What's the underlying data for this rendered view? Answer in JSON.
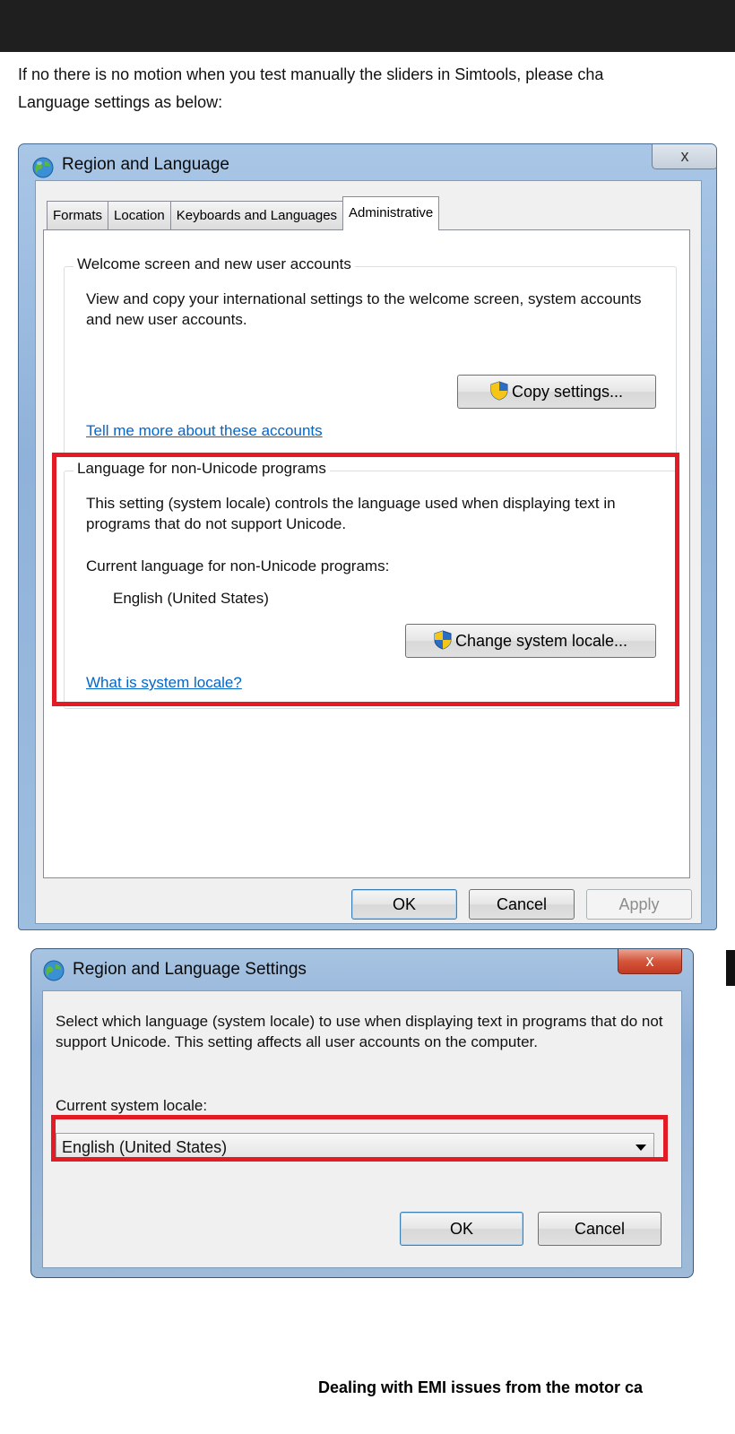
{
  "intro": {
    "line1": "If no there is no motion when you test manually the sliders in Simtools, please cha",
    "line2": "Language settings as below:"
  },
  "window1": {
    "title": "Region and Language",
    "close_glyph": "x",
    "tabs": [
      {
        "label": "Formats"
      },
      {
        "label": "Location"
      },
      {
        "label": "Keyboards and Languages"
      },
      {
        "label": "Administrative",
        "active": true
      }
    ],
    "welcome": {
      "legend": "Welcome screen and new user accounts",
      "description": "View and copy your international settings to the welcome screen, system accounts and new user accounts.",
      "copy_button": "Copy settings...",
      "link": "Tell me more about these accounts"
    },
    "nonunicode": {
      "legend": "Language for non-Unicode programs",
      "description": "This setting (system locale) controls the language used when displaying text in programs that do not support Unicode.",
      "current_label": "Current language for non-Unicode programs:",
      "current_value": "English (United States)",
      "change_button": "Change system locale...",
      "link": "What is system locale?"
    },
    "buttons": {
      "ok": "OK",
      "cancel": "Cancel",
      "apply": "Apply"
    }
  },
  "window2": {
    "title": "Region and Language Settings",
    "close_glyph": "x",
    "description": "Select which language (system locale) to use when displaying text in programs that do not support Unicode. This setting affects all user accounts on the computer.",
    "locale_label": "Current system locale:",
    "locale_value": "English (United States)",
    "buttons": {
      "ok": "OK",
      "cancel": "Cancel"
    }
  },
  "footer": {
    "heading": "Dealing with EMI issues from the motor ca"
  },
  "colors": {
    "highlight": "#e21b24",
    "link": "#0066cc",
    "topbar": "#1f1f1f"
  }
}
